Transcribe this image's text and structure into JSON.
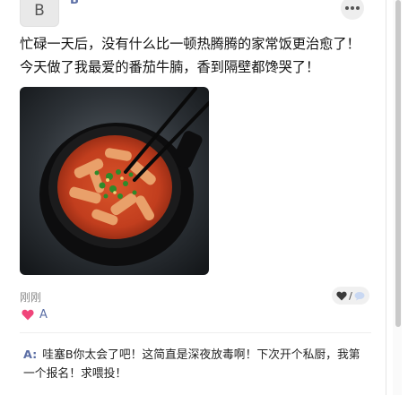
{
  "post": {
    "avatar_letter": "B",
    "author_name": "B",
    "text": "忙碌一天后，没有什么比一顿热腾腾的家常饭更治愈了！今天做了我最爱的番茄牛腩，香到隔壁都馋哭了！",
    "time": "刚刚",
    "likes": {
      "names": "A"
    },
    "reaction_icons": [
      "heart-icon",
      "comment-icon"
    ]
  },
  "comments": [
    {
      "author": "A:",
      "text": "哇塞B你太会了吧！这简直是深夜放毒啊！下次开个私厨，我第一个报名！求喂投！"
    }
  ],
  "colors": {
    "name_blue": "#5b6ea5",
    "like_heart": "#f0457a",
    "divider": "#eeeeee"
  }
}
